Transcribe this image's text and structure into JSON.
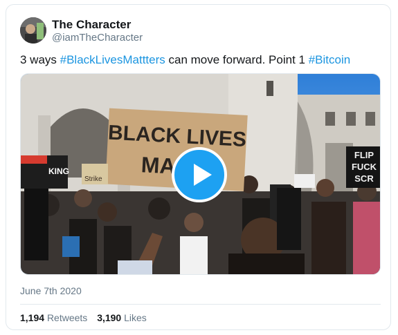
{
  "tweet": {
    "author": {
      "display_name": "The Character",
      "handle": "@iamTheCharacter",
      "avatar_icon": "avatar-photo"
    },
    "text": {
      "before": "3 ways ",
      "hashtag1": "#BlackLivesMattters",
      "middle": " can move forward. Point 1 ",
      "hashtag2": "#Bitcoin"
    },
    "media": {
      "type": "video",
      "play_icon": "play-icon",
      "sign_main_line1": "BLACK LIVES",
      "sign_main_line2": "MA",
      "sign_right_line1": "FLIP",
      "sign_right_line2": "FUCK",
      "sign_right_line3": "SCR",
      "sign_left_line1": "KING",
      "sign_left_line2": "Strike"
    },
    "date": "June 7th 2020",
    "retweets": {
      "count": "1,194",
      "label": "Retweets"
    },
    "likes": {
      "count": "3,190",
      "label": "Likes"
    },
    "colors": {
      "link": "#1b95e0",
      "play_button": "#1da1f2",
      "secondary_text": "#657786",
      "border": "#e1e8ed"
    }
  }
}
